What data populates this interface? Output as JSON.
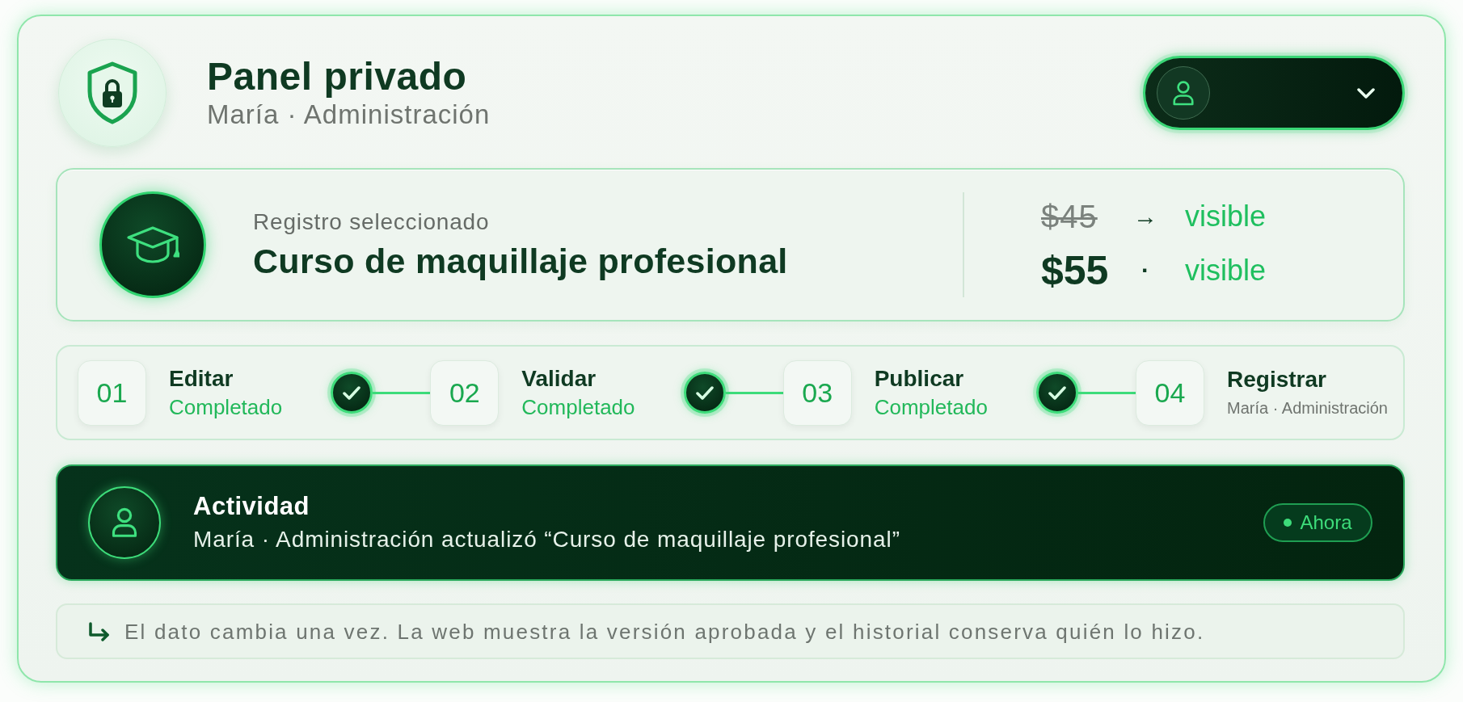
{
  "header": {
    "title": "Panel privado",
    "subtitle": "María · Administración"
  },
  "user_menu": {
    "expanded": false
  },
  "record": {
    "label": "Registro seleccionado",
    "title": "Curso de maquillaje profesional",
    "prices": [
      {
        "kind": "old",
        "price": "$45",
        "separator": "→",
        "status": "visible"
      },
      {
        "kind": "new",
        "price": "$55",
        "separator": "·",
        "status": "visible"
      }
    ]
  },
  "steps": [
    {
      "number": "01",
      "title": "Editar",
      "status": "Completado",
      "done": true
    },
    {
      "number": "02",
      "title": "Validar",
      "status": "Completado",
      "done": true
    },
    {
      "number": "03",
      "title": "Publicar",
      "status": "Completado",
      "done": true
    },
    {
      "number": "04",
      "title": "Registrar",
      "status": "María · Administración",
      "done": false
    }
  ],
  "activity": {
    "title": "Actividad",
    "message": "María · Administración actualizó “Curso de maquillaje profesional”",
    "badge": "Ahora"
  },
  "note": {
    "text": "El dato cambia una vez. La web muestra la versión aprobada y el historial conserva quién lo hizo."
  }
}
